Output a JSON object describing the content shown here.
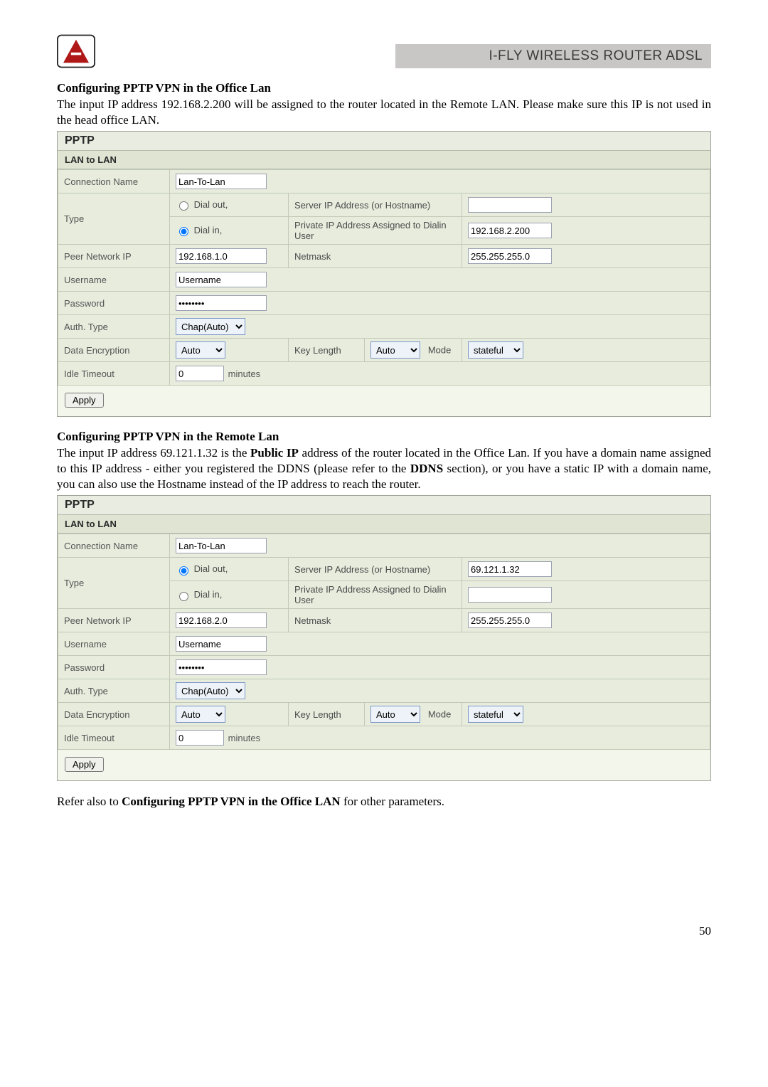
{
  "header": {
    "product_title": "I-FLY WIRELESS ROUTER ADSL"
  },
  "office": {
    "heading": "Configuring PPTP VPN in the Office Lan",
    "para": "The input IP address 192.168.2.200 will be assigned to the router located in the Remote LAN. Please make sure this IP is not used in the head office LAN.",
    "panel_title": "PPTP",
    "panel_subtitle": "LAN to LAN",
    "labels": {
      "connection_name": "Connection Name",
      "type": "Type",
      "dial_out": "Dial out,",
      "dial_in": "Dial in,",
      "server_ip": "Server IP Address (or Hostname)",
      "private_ip": "Private IP Address Assigned to Dialin User",
      "peer_network": "Peer Network IP",
      "netmask": "Netmask",
      "username": "Username",
      "password": "Password",
      "auth_type": "Auth. Type",
      "data_encryption": "Data Encryption",
      "key_length": "Key Length",
      "mode": "Mode",
      "idle_timeout": "Idle Timeout",
      "minutes": "minutes",
      "apply": "Apply"
    },
    "values": {
      "connection_name": "Lan-To-Lan",
      "server_ip": "",
      "private_ip": "192.168.2.200",
      "peer_network": "192.168.1.0",
      "netmask": "255.255.255.0",
      "username": "Username",
      "password": "••••••••",
      "auth_type": "Chap(Auto)",
      "data_encryption": "Auto",
      "key_length": "Auto",
      "mode": "stateful",
      "idle_timeout": "0",
      "type_selected": "dial_in"
    }
  },
  "remote": {
    "heading": "Configuring PPTP VPN in the Remote Lan",
    "para_parts": {
      "p1": "The input IP address 69.121.1.32 is the ",
      "b1": "Public IP",
      "p2": " address of the router located in the Office Lan. If you have a domain name assigned to this IP address - either you registered the DDNS (please refer to the ",
      "b2": "DDNS",
      "p3": " section), or you have a static IP with a domain name, you can also use the Hostname instead of the IP address to reach the router."
    },
    "panel_title": "PPTP",
    "panel_subtitle": "LAN to LAN",
    "labels": {
      "connection_name": "Connection Name",
      "type": "Type",
      "dial_out": "Dial out,",
      "dial_in": "Dial in,",
      "server_ip": "Server IP Address (or Hostname)",
      "private_ip": "Private IP Address Assigned to Dialin User",
      "peer_network": "Peer Network IP",
      "netmask": "Netmask",
      "username": "Username",
      "password": "Password",
      "auth_type": "Auth. Type",
      "data_encryption": "Data Encryption",
      "key_length": "Key Length",
      "mode": "Mode",
      "idle_timeout": "Idle Timeout",
      "minutes": "minutes",
      "apply": "Apply"
    },
    "values": {
      "connection_name": "Lan-To-Lan",
      "server_ip": "69.121.1.32",
      "private_ip": "",
      "peer_network": "192.168.2.0",
      "netmask": "255.255.255.0",
      "username": "Username",
      "password": "••••••••",
      "auth_type": "Chap(Auto)",
      "data_encryption": "Auto",
      "key_length": "Auto",
      "mode": "stateful",
      "idle_timeout": "0",
      "type_selected": "dial_out"
    }
  },
  "footer": {
    "refer_pre": "Refer also to ",
    "refer_bold": "Configuring PPTP VPN in the Office LAN",
    "refer_post": " for other parameters."
  },
  "page_number": "50"
}
